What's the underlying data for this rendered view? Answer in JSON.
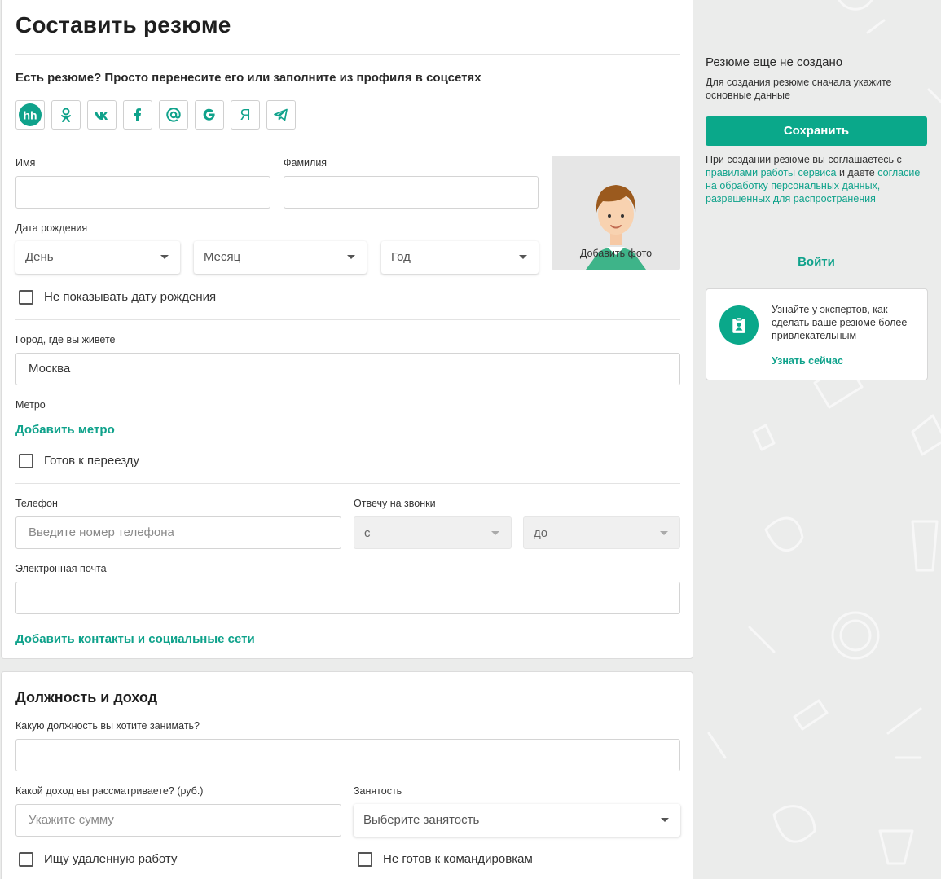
{
  "form": {
    "title": "Составить резюме",
    "import_lead": "Есть резюме? Просто перенесите его или заполните из профиля в соцсетях",
    "social_buttons": [
      {
        "name": "hh",
        "label": "hh",
        "icon": "hh-icon"
      },
      {
        "name": "odnoklassniki",
        "label": "",
        "icon": "odnoklassniki-icon"
      },
      {
        "name": "vk",
        "label": "",
        "icon": "vk-icon"
      },
      {
        "name": "facebook",
        "label": "f",
        "icon": "facebook-icon"
      },
      {
        "name": "mail",
        "label": "@",
        "icon": "mail-at-icon"
      },
      {
        "name": "google",
        "label": "G",
        "icon": "google-icon"
      },
      {
        "name": "yandex",
        "label": "Я",
        "icon": "yandex-icon"
      },
      {
        "name": "telegram",
        "label": "",
        "icon": "telegram-icon"
      }
    ],
    "first_name": {
      "label": "Имя",
      "value": ""
    },
    "last_name": {
      "label": "Фамилия",
      "value": ""
    },
    "photo": {
      "label": "Добавить фото"
    },
    "birth": {
      "label": "Дата рождения",
      "day": "День",
      "month": "Месяц",
      "year": "Год",
      "hide_label": "Не показывать дату рождения",
      "hide_checked": false
    },
    "city": {
      "label": "Город, где вы живете",
      "value": "Москва"
    },
    "metro": {
      "label": "Метро",
      "add_link": "Добавить метро"
    },
    "relocate": {
      "label": "Готов к переезду",
      "checked": false
    },
    "phone": {
      "label": "Телефон",
      "placeholder": "Введите номер телефона"
    },
    "calls": {
      "label": "Отвечу на звонки",
      "from": "с",
      "to": "до"
    },
    "email": {
      "label": "Электронная почта",
      "value": ""
    },
    "add_contacts_link": "Добавить контакты и социальные сети"
  },
  "position": {
    "title": "Должность и доход",
    "position_label": "Какую должность вы хотите занимать?",
    "position_value": "",
    "income_label": "Какой доход вы рассматриваете? (руб.)",
    "income_placeholder": "Укажите сумму",
    "employment_label": "Занятость",
    "employment_value": "Выберите занятость",
    "remote_label": "Ищу удаленную работу",
    "no_trips_label": "Не готов к командировкам"
  },
  "sidebar": {
    "status_title": "Резюме еще не создано",
    "status_sub": "Для создания резюме сначала укажите основные данные",
    "save_button": "Сохранить",
    "agree_prefix": "При создании резюме вы соглашаетесь с ",
    "agree_rules_link": "правилами работы сервиса",
    "agree_mid": " и даете ",
    "agree_consent_link": "согласие на обработку персональных данных, разрешенных для распространения",
    "login": "Войти",
    "expert_text": "Узнайте у экспертов, как сделать ваше резюме более привлекательным",
    "expert_link": "Узнать сейчас"
  },
  "colors": {
    "accent": "#0aa88a",
    "link": "#0fa28b",
    "background": "#ebeceb"
  }
}
